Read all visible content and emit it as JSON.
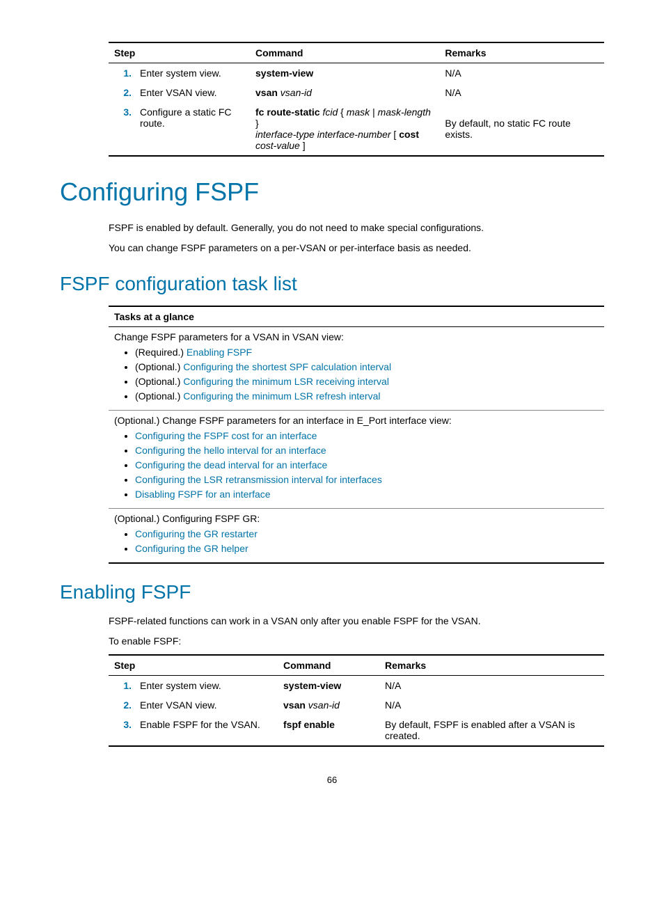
{
  "table1": {
    "headers": {
      "step": "Step",
      "command": "Command",
      "remarks": "Remarks"
    },
    "rows": [
      {
        "num": "1.",
        "step": "Enter system view.",
        "cmd_bold": "system-view",
        "cmd_rest": "",
        "remarks": "N/A"
      },
      {
        "num": "2.",
        "step": "Enter VSAN view.",
        "cmd_bold": "vsan",
        "cmd_rest": " vsan-id",
        "remarks": "N/A"
      },
      {
        "num": "3.",
        "step": "Configure a static FC route.",
        "cmd_html": "row3",
        "remarks": "By default, no static FC route exists."
      }
    ],
    "row3_cmd": {
      "p1_bold": "fc route-static",
      "p1_ital": " fcid ",
      "p1_txt1": "{ ",
      "p1_ital2": "mask",
      "p1_txt2": " | ",
      "p1_ital3": "mask-length",
      "p1_txt3": " } ",
      "p2_ital": "interface-type interface-number",
      "p2_txt1": " [ ",
      "p2_bold": "cost",
      "p3_ital": "cost-value",
      "p3_txt": " ]"
    }
  },
  "h1": "Configuring FSPF",
  "intro1": "FSPF is enabled by default. Generally, you do not need to make special configurations.",
  "intro2": "You can change FSPF parameters on a per-VSAN or per-interface basis as needed.",
  "h2_tasklist": "FSPF configuration task list",
  "tasks": {
    "header": "Tasks at a glance",
    "sec1_intro": "Change FSPF parameters for a VSAN in VSAN view:",
    "sec1_items": [
      {
        "prefix": "(Required.) ",
        "link": "Enabling FSPF"
      },
      {
        "prefix": "(Optional.) ",
        "link": "Configuring the shortest SPF calculation interval"
      },
      {
        "prefix": "(Optional.) ",
        "link": "Configuring the minimum LSR receiving interval"
      },
      {
        "prefix": "(Optional.) ",
        "link": "Configuring the minimum LSR refresh interval"
      }
    ],
    "sec2_intro": "(Optional.) Change FSPF parameters for an interface in E_Port interface view:",
    "sec2_items": [
      {
        "prefix": "",
        "link": "Configuring the FSPF cost for an interface"
      },
      {
        "prefix": "",
        "link": "Configuring the hello interval for an interface"
      },
      {
        "prefix": "",
        "link": "Configuring the dead interval for an interface"
      },
      {
        "prefix": "",
        "link": "Configuring the LSR retransmission interval for interfaces"
      },
      {
        "prefix": "",
        "link": "Disabling FSPF for an interface"
      }
    ],
    "sec3_intro": "(Optional.) Configuring FSPF GR:",
    "sec3_items": [
      {
        "prefix": "",
        "link": "Configuring the GR restarter"
      },
      {
        "prefix": "",
        "link": "Configuring the GR helper"
      }
    ]
  },
  "h2_enable": "Enabling FSPF",
  "enable_p1": "FSPF-related functions can work in a VSAN only after you enable FSPF for the VSAN.",
  "enable_p2": "To enable FSPF:",
  "table2": {
    "headers": {
      "step": "Step",
      "command": "Command",
      "remarks": "Remarks"
    },
    "rows": [
      {
        "num": "1.",
        "step": "Enter system view.",
        "cmd_bold": "system-view",
        "cmd_rest": "",
        "remarks": "N/A"
      },
      {
        "num": "2.",
        "step": "Enter VSAN view.",
        "cmd_bold": "vsan",
        "cmd_rest": " vsan-id",
        "remarks": "N/A"
      },
      {
        "num": "3.",
        "step": "Enable FSPF for the VSAN.",
        "cmd_bold": "fspf enable",
        "cmd_rest": "",
        "remarks": "By default, FSPF is enabled after a VSAN is created."
      }
    ]
  },
  "page_number": "66"
}
